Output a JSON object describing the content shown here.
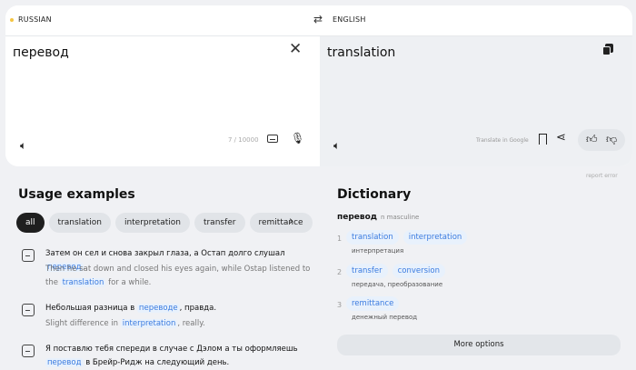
{
  "header": {
    "source_lang": "RUSSIAN",
    "target_lang": "ENGLISH",
    "swap_icon": "⇄"
  },
  "source": {
    "text": "перевод",
    "counter": "7 / 10000"
  },
  "target": {
    "text": "translation",
    "translate_in_google": "Translate in Google",
    "report_error": "report error"
  },
  "usage": {
    "title": "Usage examples",
    "filters": [
      "all",
      "translation",
      "interpretation",
      "transfer",
      "remittance"
    ],
    "examples": [
      {
        "ru_before": "Затем он сел и снова закрыл глаза, а Остап долго слушал ",
        "ru_hl": "перевод",
        "ru_after": ".",
        "en_before": "Then he sat down and closed his eyes again, while Ostap listened to the ",
        "en_hl": "translation",
        "en_after": " for a while."
      },
      {
        "ru_before": "Небольшая разница в ",
        "ru_hl": "переводе",
        "ru_after": ", правда.",
        "en_before": "Slight difference in ",
        "en_hl": "interpretation",
        "en_after": ", really."
      },
      {
        "ru_before": "Я поставлю тебя спереди в случае с Дэлом а ты оформляешь ",
        "ru_hl": "перевод",
        "ru_after": " в Брейр-Ридж на следующий день."
      }
    ]
  },
  "dictionary": {
    "title": "Dictionary",
    "word": "перевод",
    "grammar": "n  masculine",
    "senses": [
      {
        "num": "1",
        "tags": [
          "translation",
          "interpretation"
        ],
        "gloss": "интерпретация"
      },
      {
        "num": "2",
        "tags": [
          "transfer",
          "conversion"
        ],
        "gloss": "передача, преобразование"
      },
      {
        "num": "3",
        "tags": [
          "remittance"
        ],
        "gloss": "денежный перевод"
      }
    ],
    "more_options": "More options"
  }
}
